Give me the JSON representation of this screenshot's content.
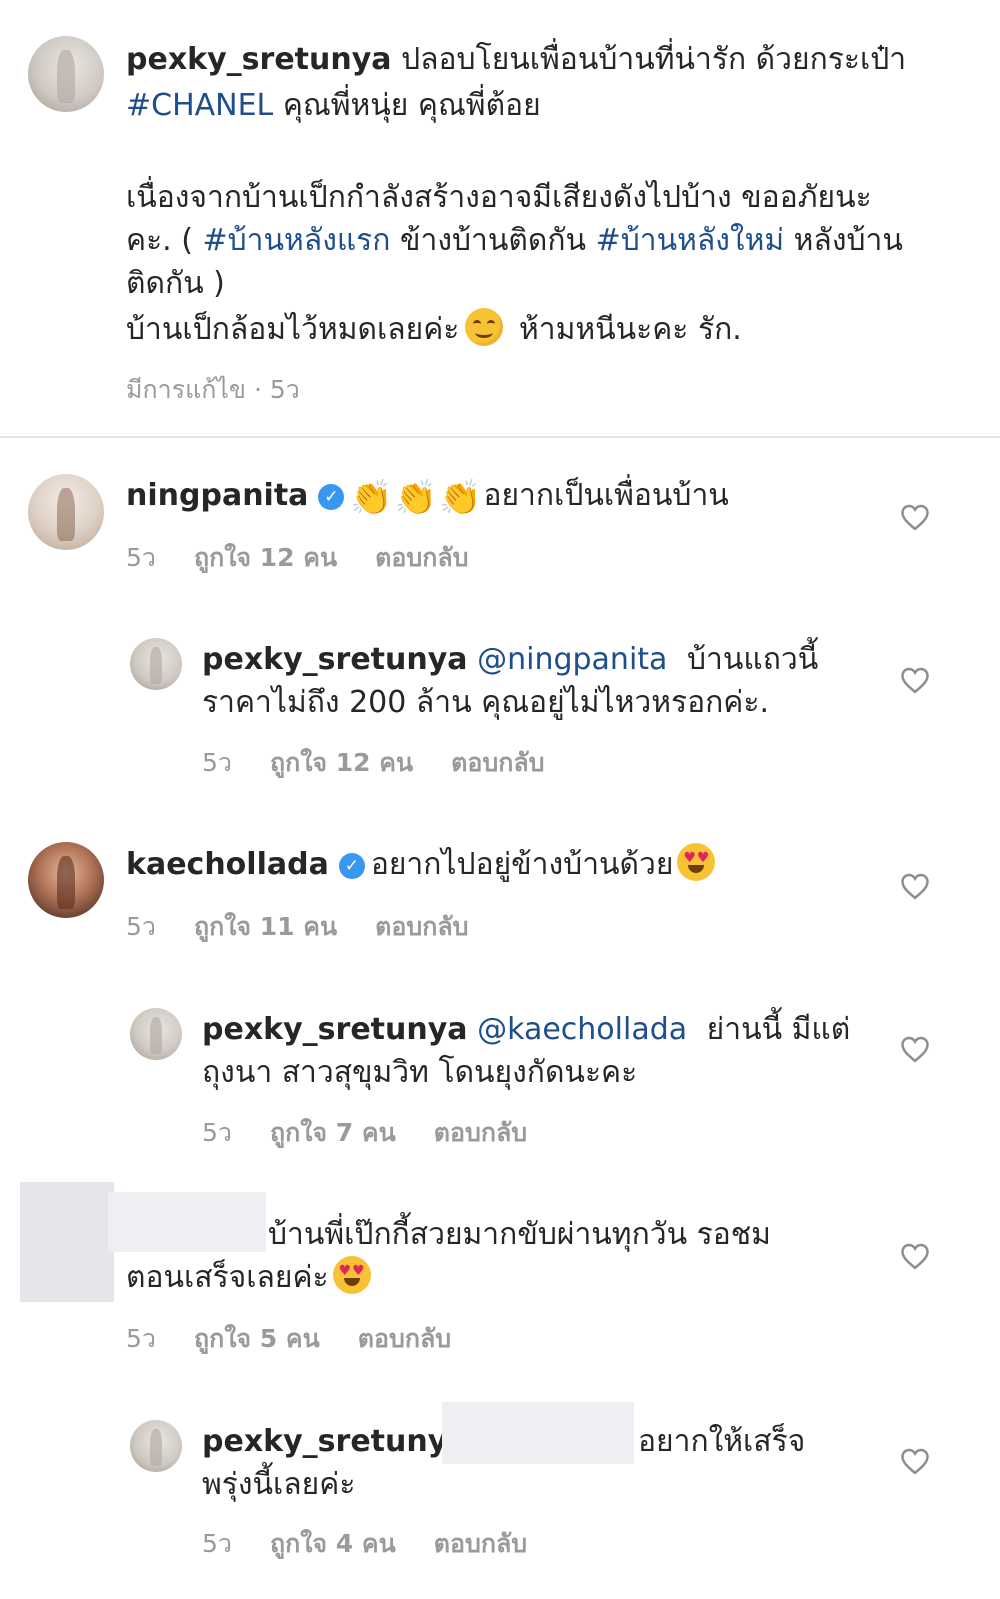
{
  "post": {
    "username": "pexky_sretunya",
    "line1": "ปลอบโยนเพื่อนบ้านที่น่ารัก ด้วยกระเป๋า",
    "hashtag_chanel": "#CHANEL",
    "line2_rest": " คุณพี่หนุ่ย คุณพี่ต้อย",
    "line3": "เนื่องจากบ้านเป็กกำลังสร้างอาจมีเสียงดังไปบ้าง ขออภัยนะ",
    "line4_a": "คะ. ( ",
    "hashtag_first": "#บ้านหลังแรก",
    "line4_b": " ข้างบ้านติดกัน ",
    "hashtag_new": "#บ้านหลังใหม่",
    "line4_c": " หลังบ้าน",
    "line5": "ติดกัน )",
    "line6_a": "บ้านเป็กล้อมไว้หมดเลยค่ะ",
    "line6_b": " ห้ามหนีนะคะ รัก.",
    "meta": "มีการแก้ไข · 5ว"
  },
  "comments": [
    {
      "username": "ningpanita",
      "text": "อยากเป็นเพื่อนบ้าน",
      "time": "5ว",
      "likes": "ถูกใจ 12 คน",
      "reply": "ตอบกลับ"
    },
    {
      "username": "pexky_sretunya",
      "mention": "@ningpanita",
      "text1": "บ้านแถวนี้",
      "text2": "ราคาไม่ถึง 200 ล้าน คุณอยู่ไม่ไหวหรอกค่ะ.",
      "time": "5ว",
      "likes": "ถูกใจ 12 คน",
      "reply": "ตอบกลับ"
    },
    {
      "username": "kaechollada",
      "text": "อยากไปอยู่ข้างบ้านด้วย",
      "time": "5ว",
      "likes": "ถูกใจ 11 คน",
      "reply": "ตอบกลับ"
    },
    {
      "username": "pexky_sretunya",
      "mention": "@kaechollada",
      "text1": "ย่านนี้ มีแต่",
      "text2": "ถุงนา สาวสุขุมวิท โดนยุงกัดนะคะ",
      "time": "5ว",
      "likes": "ถูกใจ 7 คน",
      "reply": "ตอบกลับ"
    },
    {
      "text1": "บ้านพี่เป๊กกี้สวยมากขับผ่านทุกวัน รอชม",
      "text2": "ตอนเสร็จเลยค่ะ",
      "time": "5ว",
      "likes": "ถูกใจ 5 คน",
      "reply": "ตอบกลับ"
    },
    {
      "username": "pexky_sretunya",
      "text1": "อยากให้เสร็จ",
      "text2": "พรุ่งนี้เลยค่ะ",
      "time": "5ว",
      "likes": "ถูกใจ 4 คน",
      "reply": "ตอบกลับ"
    }
  ],
  "icons": {
    "heart": "heart-outline-icon",
    "verified": "verified-badge-icon",
    "clap": "clapping-hands-emoji",
    "smile": "smiling-face-emoji",
    "love": "heart-eyes-emoji"
  },
  "colors": {
    "link": "#1f4e8c",
    "meta": "#9a9a9a",
    "verified": "#3897f0"
  }
}
